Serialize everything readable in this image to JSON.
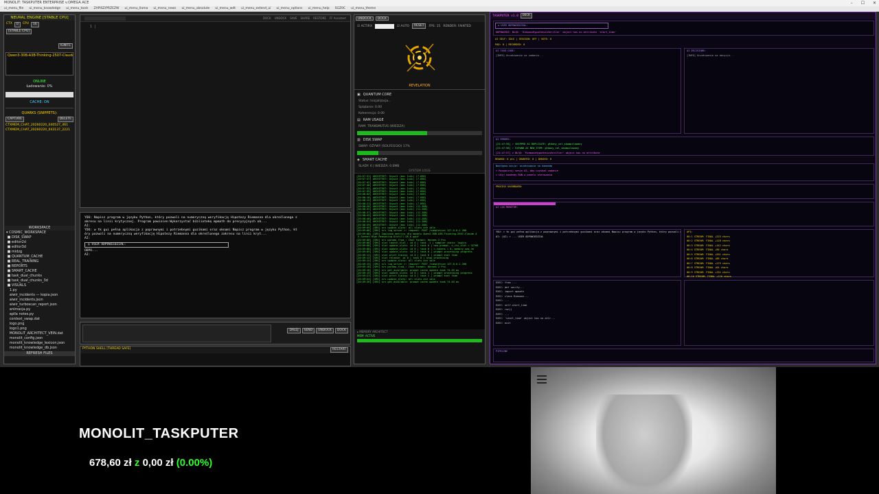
{
  "window": {
    "title": "MONOLIT: TASKPUTER ENTERPRISE v.OMEGA ACE"
  },
  "menu": [
    "ui_menu_file",
    "ui_menu_knowledge",
    "ui_menu_tools",
    "ZAPISZ/PRZEZW",
    "ui_menu_llama",
    "ui_menu_news",
    "ui_menu_absolute",
    "ui_menu_wdt",
    "ui_menu_extend_ui",
    "ui_menu_options",
    "ui_menu_help",
    "SGZ0C",
    "ui_menu_theme"
  ],
  "left": {
    "engine_title": "NEURAL ENGINE [STABLE CPU]",
    "ctx_label": "CTX",
    "cpu_label": "CPU",
    "stable_tag": "[STABLE CPU]",
    "ignite": "IGNITE",
    "model": "Qwen3-30B-A3B-Thinking-2507-Claude-",
    "status": "ONLINE",
    "loading": "Ładowanie: 0%",
    "cache": "CACHE: ON",
    "quarks": "QUARKS (SNIPPETS):",
    "capture": "CAPTURE",
    "delete": "DELETE",
    "snippets": [
      "CTXMEM_CHAT_20260220_040527_461",
      "CTXMEM_CHAT_20260220_043137_2221"
    ],
    "workspace": "WORKSPACE",
    "tree": [
      "COSMIC_WORKSPACE",
      "DISK_SWAP",
      "editor2d",
      "editor3d",
      "midzg",
      "QUANTUM_CACHE",
      "REAL_TRAINING",
      "REPORTS",
      "SMART_CACHE",
      "task_dual_chunks",
      "task_dual_chunks_3d",
      "VISUALS",
      "1.py",
      "aiwir_incidents — kopia.json",
      "aiwir_incidents.json",
      "aiwir_turboscan_report.json",
      "animacja.py",
      "aplla notes.py",
      "context_swap.dat",
      "logo.png",
      "logo1.png",
      "MONOLIT_ARCHITECT_VEIN.dat",
      "monolit_config.json",
      "monolit_knowledge_lexicon.json",
      "monolit_knowledge_db.json"
    ],
    "refresh": "REFRESH FILES"
  },
  "editor": {
    "toolbar": [
      "DOCK",
      "UNDOCK",
      "SAVE",
      "SHARE",
      "RESTORE",
      "FF Assistant"
    ]
  },
  "chat": {
    "lines": [
      "YOU: Napisz program w języku Python, który pozwoli na numeryczną weryfikację Hipotezy Riemanna dla określonego z",
      "akresu na linii krytycznej. Program powinien:Wykorzystać bibliotekę mpmath do precyzyjnych ob...",
      "AI:",
      "YOU: w tk gui pełna aplikacja z poprawnymi i potrzebnymi guzikami oraz oknami Napisz program w języku Python, kt",
      "óry pozwoli na numeryczną weryfikację Hipotezy Riemanna dla określonego zakresu na linii kryt...",
      "AI:"
    ],
    "user_answer": "USER ODPOWIEDZIAŁ:",
    "reply": "ODPO...",
    "tail": "AI:"
  },
  "shell": {
    "buttons": [
      "DALEJ",
      "SEND",
      "UNDOCK",
      "DOCK"
    ],
    "label": "PYTHON SHELL [THREAD SAFE]",
    "restart": "RESTART"
  },
  "mid": {
    "undock": "UNDOCK",
    "dock": "DOCK",
    "actirx": "ACTIRX",
    "auto": "AUTO",
    "reset": "RESET",
    "fps": "FPS: 15",
    "render": "RENDER: FAINTED",
    "revelation": "REVELATION",
    "quantum_core": "QUANTUM CORE",
    "status_init": "Status: Inicjalizacja...",
    "splatanie": "Splątanie: 0.00",
    "koherencja": "Koherencja: 0.00",
    "ram_usage": "RAM USAGE",
    "ram_trans": "RAM: TRANSMUTUS (WIEDZA)",
    "ram_level": 0.56,
    "disk_swap": "DISK SWAP",
    "swap_text": "SWAP: OŻYWY (SOLFEGGIO) 17%",
    "swap_level": 0.17,
    "smart_cache": "SMART CACHE",
    "slady": "ŚLADY: 6 | WIEDZA: 0.0MB",
    "system_logs": "SYSTEM LOGS",
    "memory": "MEMORY ARCHITECT",
    "mem_status": "MEM: ACTIVE",
    "logs": [
      "[20:07:31] ARCHITEKT: Ożywił (moc 1x4x) (7.058)",
      "[20:07:37] ARCHITEKT: Ożywił (moc 1x4x) (7.058)",
      "[20:07:42] ARCHITEKT: Ożywił (moc 1x4x) (7.058)",
      "[20:07:48] ARCHITEKT: Ożywił (moc 1x4x) (7.058)",
      "[20:07:53] ARCHITEKT: Ożywił (moc 1x4x) (7.058)",
      "[20:07:59] ARCHITEKT: Ożywił (moc 1x4x) (7.058)",
      "[20:08:04] ARCHITEKT: Ożywił (moc 1x4x) (7.058)",
      "[20:08:10] ARCHITEKT: Ożywił (moc 1x4x) (7.058)",
      "[20:08:15] ARCHITEKT: Ożywił (moc 1x4x) (7.058)",
      "[20:08:21] ARCHITEKT: Ożywił (moc 1x4x) (7.058)",
      "[20:08:26] ARCHITEKT: Ożywił (moc 1x4x) (11.288)",
      "[20:08:32] ARCHITEKT: Ożywił (moc 1x4x) (11.288)",
      "[20:08:37] ARCHITEKT: Ożywił (moc 1x4x) (11.288)",
      "[20:08:43] ARCHITEKT: Ożywił (moc 1x4x) (11.288)",
      "[20:08:48] ARCHITEKT: Ożywił (moc 1x4x) (11.288)",
      "[20:08:54] ARCHITEKT: Ożywił (moc 1x4x) (11.288)",
      "[20:08:59] ARCHITEKT: Ożywił (moc 1x4x) (11.288)",
      "[20:09:05] [SRV] srv  update_slots: all slots are idle",
      "[20:09:08] [SRV] srv  log_server_r: request: POST /completion 127.0.0.1 200",
      "[20:09:08] [SRV] Zapisano metrics dla modelu Qwen3-30B-A3B-Thinking-2507-Claude-4",
      "  .5-Sonnet-High-Reasoning-Distill-Q6_K.gguf",
      "[20:09:08] [SRV] srv  params_from_: Chat format: Hermes 2 Pro",
      "[20:09:08] [SRV] slot launch_slot_: id 0 | task -1 | sampler chain: logits",
      "[20:09:08] [SRV] slot update_slots: id 0 | task 0 | new prompt, n_ctx_slot = 32768",
      "[20:09:08] [SRV] slot update_slots: id 0 | task 0 | n_tokens = 0, memory_seq_rm",
      "[20:09:09] [SRV] slot update_slots: id 0 | task 0 | prompt processing progress",
      "[20:09:12] [SRV] slot print_timing: id 0 | task 0 | prompt eval time",
      "[20:09:12] [SRV] slot release: id 0 | task 0 | stop processing",
      "[20:09:15] [SRV] srv  update_slots: all slots are idle",
      "[20:09:15] [SRV] srv  log_server_r: request: POST /completion 127.0.0.1 200",
      "[20:09:18] [SRV] srv  params_from_: Chat format: Hermes 2 Pro",
      "[20:09:18] [SRV] srv  get_available: prompt cache update took 74.03 ms",
      "[20:09:19] [SRV] slot update_slots: id 0 | task 1 | prompt processing progress",
      "[20:09:21] [SRV] slot print_timing: id 0 | task 1 | prompt eval time",
      "[20:09:24] [SRV] srv  update_slots: all slots are idle",
      "[20:09:26] [SRV] srv  get_available: prompt cache update took 74.03 ms"
    ]
  },
  "right": {
    "title": "TASKPUTER v1.0",
    "tab": "DOCK",
    "user_answer": "USER ODPOWIEDZIAŁ:",
    "error": "ODPOWIEDŹ: BŁĄD: 'RiemannHypothesisVerifier' object has no attribute 'start_time'",
    "self_line": "AI SELF: IDLE | SESSION: OFF | VOTE: 0",
    "pad_label": "PAD: 0 | RECORDED: 0",
    "task_code": "AI TASK CODE:",
    "decisions": "AI DECISIONS:",
    "task_placeholder": "[INFO] Oczekiwanie na zadanie...",
    "dec_placeholder": "[INFO] Oczekiwanie na decyzje...",
    "errors_title": "AI ERRORS:",
    "errors": [
      "[21:47:55] ✓ SKIPPED AI DUPLICATE: główny_cel_skompilowany",
      "[21:47:56] ✓ EXPAND AI NEW_ITEM: główny_cel_skompilowany",
      "[21:47:57] ✗ BŁĄD: 'RiemannHypothesisVerifier' object has no attribute",
      "[21:47:58] ✓ Synchronizacja pamięci zakończona"
    ],
    "reward": "REWARD: 0 pts | GRANTED: 0 | DENIED: 0",
    "next_mission": "Następna misja: oczekiwanie na komendę",
    "hints": [
      "> Rozpocznij sesję AI, aby uzyskać zadanie",
      "> Użyj komendy RUN w panelu sterowania"
    ],
    "process": "PROCESS DASHBOARD:",
    "log_monitor": "AI LOG MONITOR:",
    "chat_line": "YOU: > tk gui pełna aplikacja z poprawnymi i potrzebnymi guzikami oraz oknami Napisz program w języku Python, który pozwoli n...",
    "chat_line2": "AI: (AI) > ... USER ODPOWIEDZIAŁ",
    "api": "API:",
    "streams": [
      "00:1 STREAM: FINAL +225 chars",
      "00:2 STREAM: FINAL +118 chars",
      "00:3 STREAM: FINAL +142 chars",
      "00:4 STREAM: FINAL +96 chars",
      "00:5 STREAM: FINAL +201 chars",
      "00:6 STREAM: FINAL +88 chars",
      "00:7 STREAM: FINAL +175 chars",
      "00:8 STREAM: FINAL +64 chars",
      "00:9 STREAM: FINAL +132 chars",
      "00:10 STREAM: FINAL +110 chars",
      "00:11 STREAM: FINAL +99 chars"
    ],
    "code_lines": [
      "EXEC: from ...",
      "EXEC: def verify...",
      "EXEC: import mpmath",
      "EXEC: class Riemann...",
      "EXEC: ...",
      "EXEC: self.start_time",
      "EXEC: run()",
      "EXEC: ...",
      "EXEC: 'start_time' object has no attr...",
      "EXEC: exit"
    ],
    "bottom_label": "PIPELINE"
  },
  "bottom": {
    "brand": "MONOLIT_TASKPUTER",
    "price_value": "678,60 zł",
    "price_mid": "z",
    "price_base": "0,00 zł",
    "price_pct": "(0.00%)"
  },
  "colors": {
    "accent_green": "#1fb81f",
    "terminal_green": "#42e542",
    "magenta": "#ff60ff",
    "purple": "#7a3aa8",
    "pct_green": "#2cff2c"
  }
}
